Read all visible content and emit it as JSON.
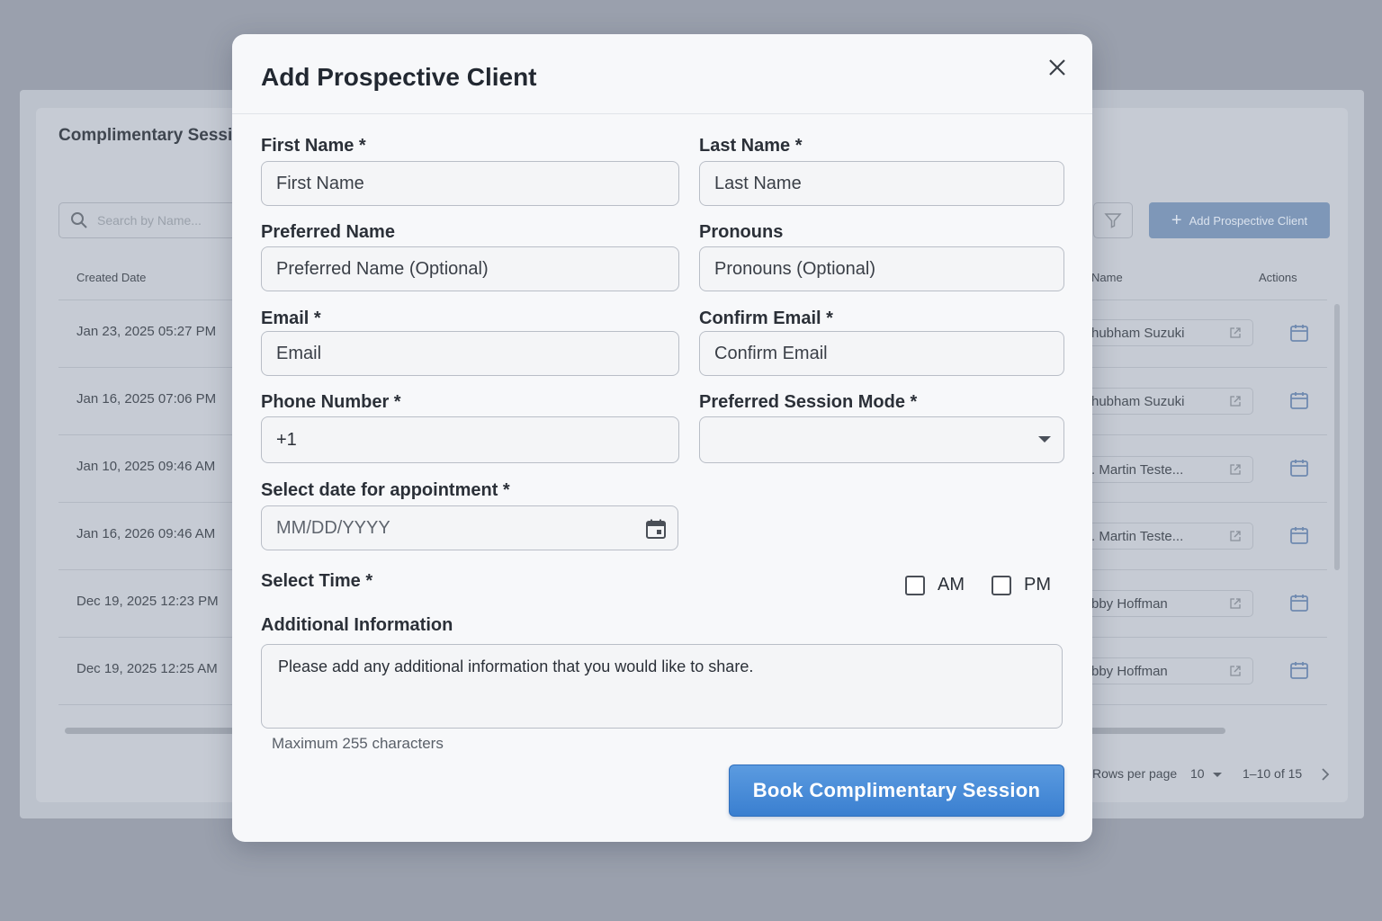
{
  "background": {
    "title": "Complimentary Sessi",
    "search_placeholder": "Search by Name...",
    "add_button": "Add Prospective Client",
    "columns": {
      "created_date": "Created Date",
      "name": "Name",
      "actions": "Actions"
    },
    "rows": [
      {
        "date": "Jan 23, 2025 05:27 PM",
        "name": "hubham Suzuki"
      },
      {
        "date": "Jan 16, 2025 07:06 PM",
        "name": "hubham Suzuki"
      },
      {
        "date": "Jan 10, 2025 09:46 AM",
        "name": ". Martin Teste..."
      },
      {
        "date": "Jan 16, 2026 09:46 AM",
        "name": ". Martin Teste..."
      },
      {
        "date": "Dec 19, 2025 12:23 PM",
        "name": "bby Hoffman"
      },
      {
        "date": "Dec 19, 2025 12:25 AM",
        "name": "bby Hoffman"
      }
    ],
    "footer": {
      "rows_per_page_label": "Rows per page",
      "rows_per_page_value": "10",
      "range": "1–10 of 15"
    }
  },
  "modal": {
    "title": "Add Prospective Client",
    "fields": {
      "first_name": {
        "label": "First Name *",
        "placeholder": "First Name"
      },
      "last_name": {
        "label": "Last Name *",
        "placeholder": "Last Name"
      },
      "preferred_name": {
        "label": "Preferred Name",
        "placeholder": "Preferred Name (Optional)"
      },
      "pronouns": {
        "label": "Pronouns",
        "placeholder": "Pronouns (Optional)"
      },
      "email": {
        "label": "Email *",
        "placeholder": "Email"
      },
      "confirm_email": {
        "label": "Confirm Email *",
        "placeholder": "Confirm Email"
      },
      "phone": {
        "label": "Phone Number *",
        "value": "+1"
      },
      "session_mode": {
        "label": "Preferred Session Mode *",
        "value": ""
      },
      "date": {
        "label": "Select date for appointment *",
        "placeholder": "MM/DD/YYYY"
      },
      "time": {
        "label": "Select Time *",
        "options": [
          "AM",
          "PM"
        ]
      },
      "additional_info": {
        "label": "Additional Information",
        "placeholder": "Please add any additional information that you would like to share.",
        "helper": "Maximum 255 characters"
      }
    },
    "submit_label": "Book Complimentary Session"
  },
  "colors": {
    "primary": "#4a8ad8",
    "overlay": "#9aa0ad"
  }
}
